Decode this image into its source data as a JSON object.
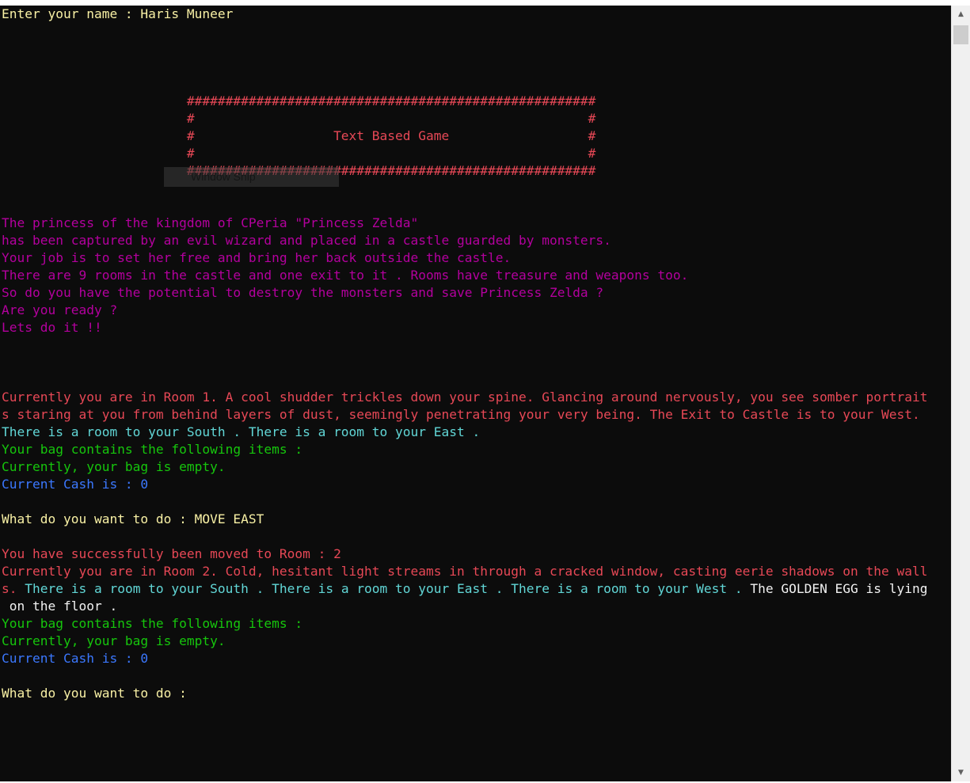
{
  "colors": {
    "background": "#0c0c0c",
    "yellow": "#f9f1a5",
    "red": "#e74856",
    "magenta": "#b4009e",
    "cyan": "#61d6d6",
    "green": "#16c60c",
    "blue": "#3b78ff",
    "white": "#f2f2f2"
  },
  "tooltip": {
    "label": "Window Snip"
  },
  "scrollbar": {
    "up_icon": "▲",
    "down_icon": "▼"
  },
  "console": {
    "lines": [
      [
        {
          "text": "Enter your name : Haris Muneer",
          "color": "yellow"
        }
      ],
      [
        {
          "text": "",
          "color": "white"
        }
      ],
      [
        {
          "text": "",
          "color": "white"
        }
      ],
      [
        {
          "text": "",
          "color": "white"
        }
      ],
      [
        {
          "text": "",
          "color": "white"
        }
      ],
      [
        {
          "text": "                        #####################################################",
          "color": "red"
        }
      ],
      [
        {
          "text": "                        #                                                   #",
          "color": "red"
        }
      ],
      [
        {
          "text": "                        #                  Text Based Game                  #",
          "color": "red"
        }
      ],
      [
        {
          "text": "                        #                                                   #",
          "color": "red"
        }
      ],
      [
        {
          "text": "                        #####################################################",
          "color": "red"
        }
      ],
      [
        {
          "text": "",
          "color": "white"
        }
      ],
      [
        {
          "text": "",
          "color": "white"
        }
      ],
      [
        {
          "text": "The princess of the kingdom of CPeria \"Princess Zelda\"",
          "color": "magenta"
        }
      ],
      [
        {
          "text": "has been captured by an evil wizard and placed in a castle guarded by monsters.",
          "color": "magenta"
        }
      ],
      [
        {
          "text": "Your job is to set her free and bring her back outside the castle.",
          "color": "magenta"
        }
      ],
      [
        {
          "text": "There are 9 rooms in the castle and one exit to it . Rooms have treasure and weapons too.",
          "color": "magenta"
        }
      ],
      [
        {
          "text": "So do you have the potential to destroy the monsters and save Princess Zelda ?",
          "color": "magenta"
        }
      ],
      [
        {
          "text": "Are you ready ?",
          "color": "magenta"
        }
      ],
      [
        {
          "text": "Lets do it !!",
          "color": "magenta"
        }
      ],
      [
        {
          "text": "",
          "color": "white"
        }
      ],
      [
        {
          "text": "",
          "color": "white"
        }
      ],
      [
        {
          "text": "",
          "color": "white"
        }
      ],
      [
        {
          "text": "Currently you are in Room 1. A cool shudder trickles down your spine. Glancing around nervously, you see somber portrait",
          "color": "red"
        }
      ],
      [
        {
          "text": "s staring at you from behind layers of dust, seemingly penetrating your very being. The Exit to Castle is to your West.",
          "color": "red"
        }
      ],
      [
        {
          "text": "There is a room to your South . There is a room to your East .",
          "color": "cyan"
        }
      ],
      [
        {
          "text": "Your bag contains the following items :",
          "color": "green"
        }
      ],
      [
        {
          "text": "Currently, your bag is empty.",
          "color": "green"
        }
      ],
      [
        {
          "text": "Current Cash is : 0",
          "color": "blue"
        }
      ],
      [
        {
          "text": "",
          "color": "white"
        }
      ],
      [
        {
          "text": "What do you want to do : MOVE EAST",
          "color": "yellow"
        }
      ],
      [
        {
          "text": "",
          "color": "white"
        }
      ],
      [
        {
          "text": "You have successfully been moved to Room : 2",
          "color": "red"
        }
      ],
      [
        {
          "text": "Currently you are in Room 2. Cold, hesitant light streams in through a cracked window, casting eerie shadows on the wall",
          "color": "red"
        }
      ],
      [
        {
          "text": "s. ",
          "color": "red"
        },
        {
          "text": "There is a room to your South . There is a room to your East . There is a room to your West . ",
          "color": "cyan"
        },
        {
          "text": "The GOLDEN EGG is lying",
          "color": "white"
        }
      ],
      [
        {
          "text": " on the floor .",
          "color": "white"
        }
      ],
      [
        {
          "text": "Your bag contains the following items :",
          "color": "green"
        }
      ],
      [
        {
          "text": "Currently, your bag is empty.",
          "color": "green"
        }
      ],
      [
        {
          "text": "Current Cash is : 0",
          "color": "blue"
        }
      ],
      [
        {
          "text": "",
          "color": "white"
        }
      ],
      [
        {
          "text": "What do you want to do : ",
          "color": "yellow"
        }
      ]
    ]
  }
}
